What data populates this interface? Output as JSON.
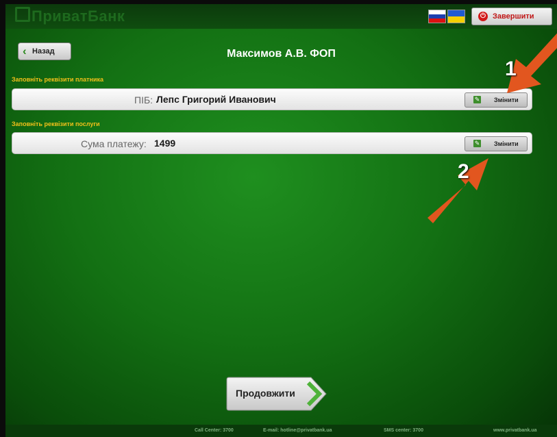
{
  "header": {
    "logo": "ПриватБанк",
    "end_button": "Завершити",
    "languages": [
      "ru-flag-icon",
      "ua-flag-icon"
    ]
  },
  "navigation": {
    "back_button": "Назад"
  },
  "page_title": "Максимов А.В. ФОП",
  "sections": [
    {
      "label": "Заповніть реквізити платника",
      "field_label": "ПІБ:",
      "value": "Лепс Григорий Иванович",
      "edit_button": "Змінити"
    },
    {
      "label": "Заповніть реквізити послуги",
      "field_label": "Сума платежу:",
      "value": "1499",
      "edit_button": "Змінити"
    }
  ],
  "continue_button": "Продовжити",
  "annotations": [
    "1",
    "2"
  ],
  "footer": {
    "call_center": "Call Center: 3700",
    "email": "E-mail: hotline@privatbank.ua",
    "sms": "SMS center: 3700",
    "site": "www.privatbank.ua"
  },
  "colors": {
    "background": "#137013",
    "section_label": "#f2c01a",
    "arrow": "#e2561f",
    "end_button_text": "#c01515"
  }
}
